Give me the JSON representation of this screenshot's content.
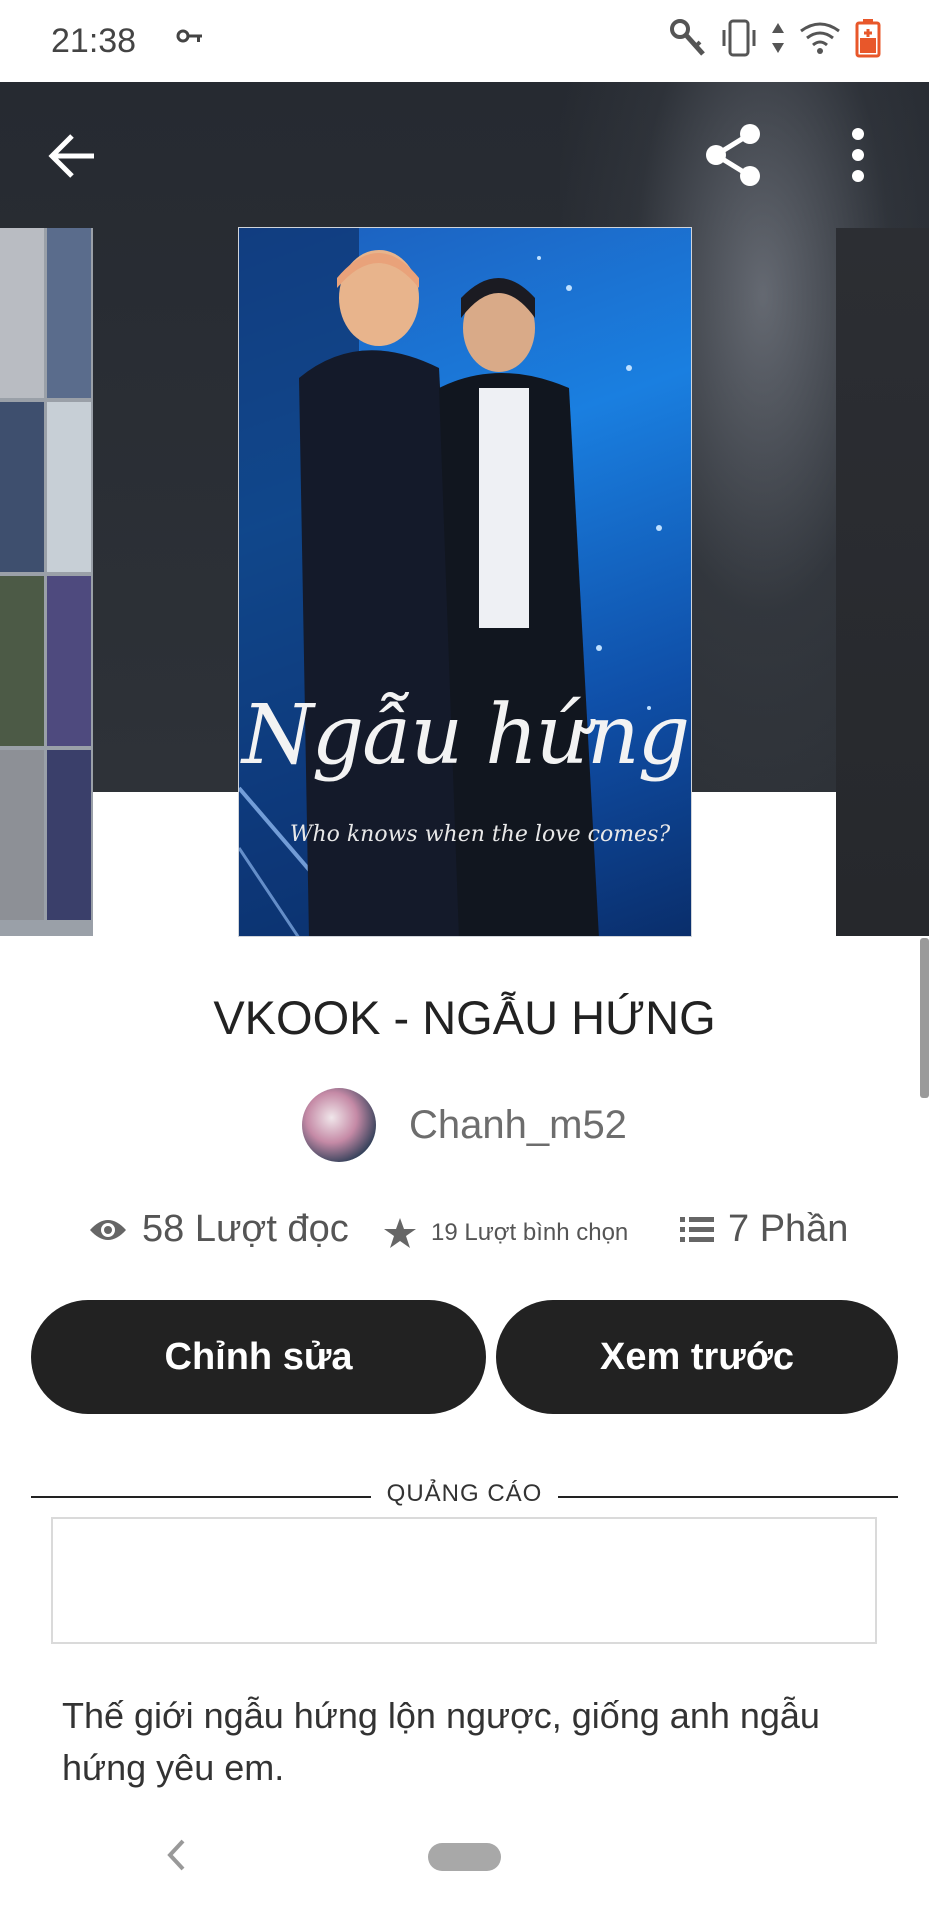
{
  "status_bar": {
    "time": "21:38",
    "icons": [
      "vpn-key-icon",
      "key-icon",
      "vibrate-icon",
      "data-arrows-icon",
      "wifi-icon",
      "battery-icon"
    ],
    "battery_color": "#e8572a"
  },
  "toolbar": {
    "back_icon": "arrow-left-icon",
    "share_icon": "share-icon",
    "more_icon": "more-vertical-icon"
  },
  "cover": {
    "title": "Ngẫu hứng",
    "subtitle": "Who knows when the love comes?"
  },
  "story": {
    "title": "VKOOK - NGẪU HỨNG",
    "author": "Chanh_m52"
  },
  "stats": {
    "reads": "58 Lượt đọc",
    "votes": "19 Lượt bình chọn",
    "parts": "7 Phần"
  },
  "actions": {
    "edit_label": "Chỉnh sửa",
    "preview_label": "Xem trước"
  },
  "ad": {
    "label": "QUẢNG CÁO"
  },
  "description": "Thế giới ngẫu hứng lộn ngược, giống anh ngẫu hứng yêu em.",
  "colors": {
    "button_bg": "#222222",
    "header_bg": "#2a2e34"
  }
}
